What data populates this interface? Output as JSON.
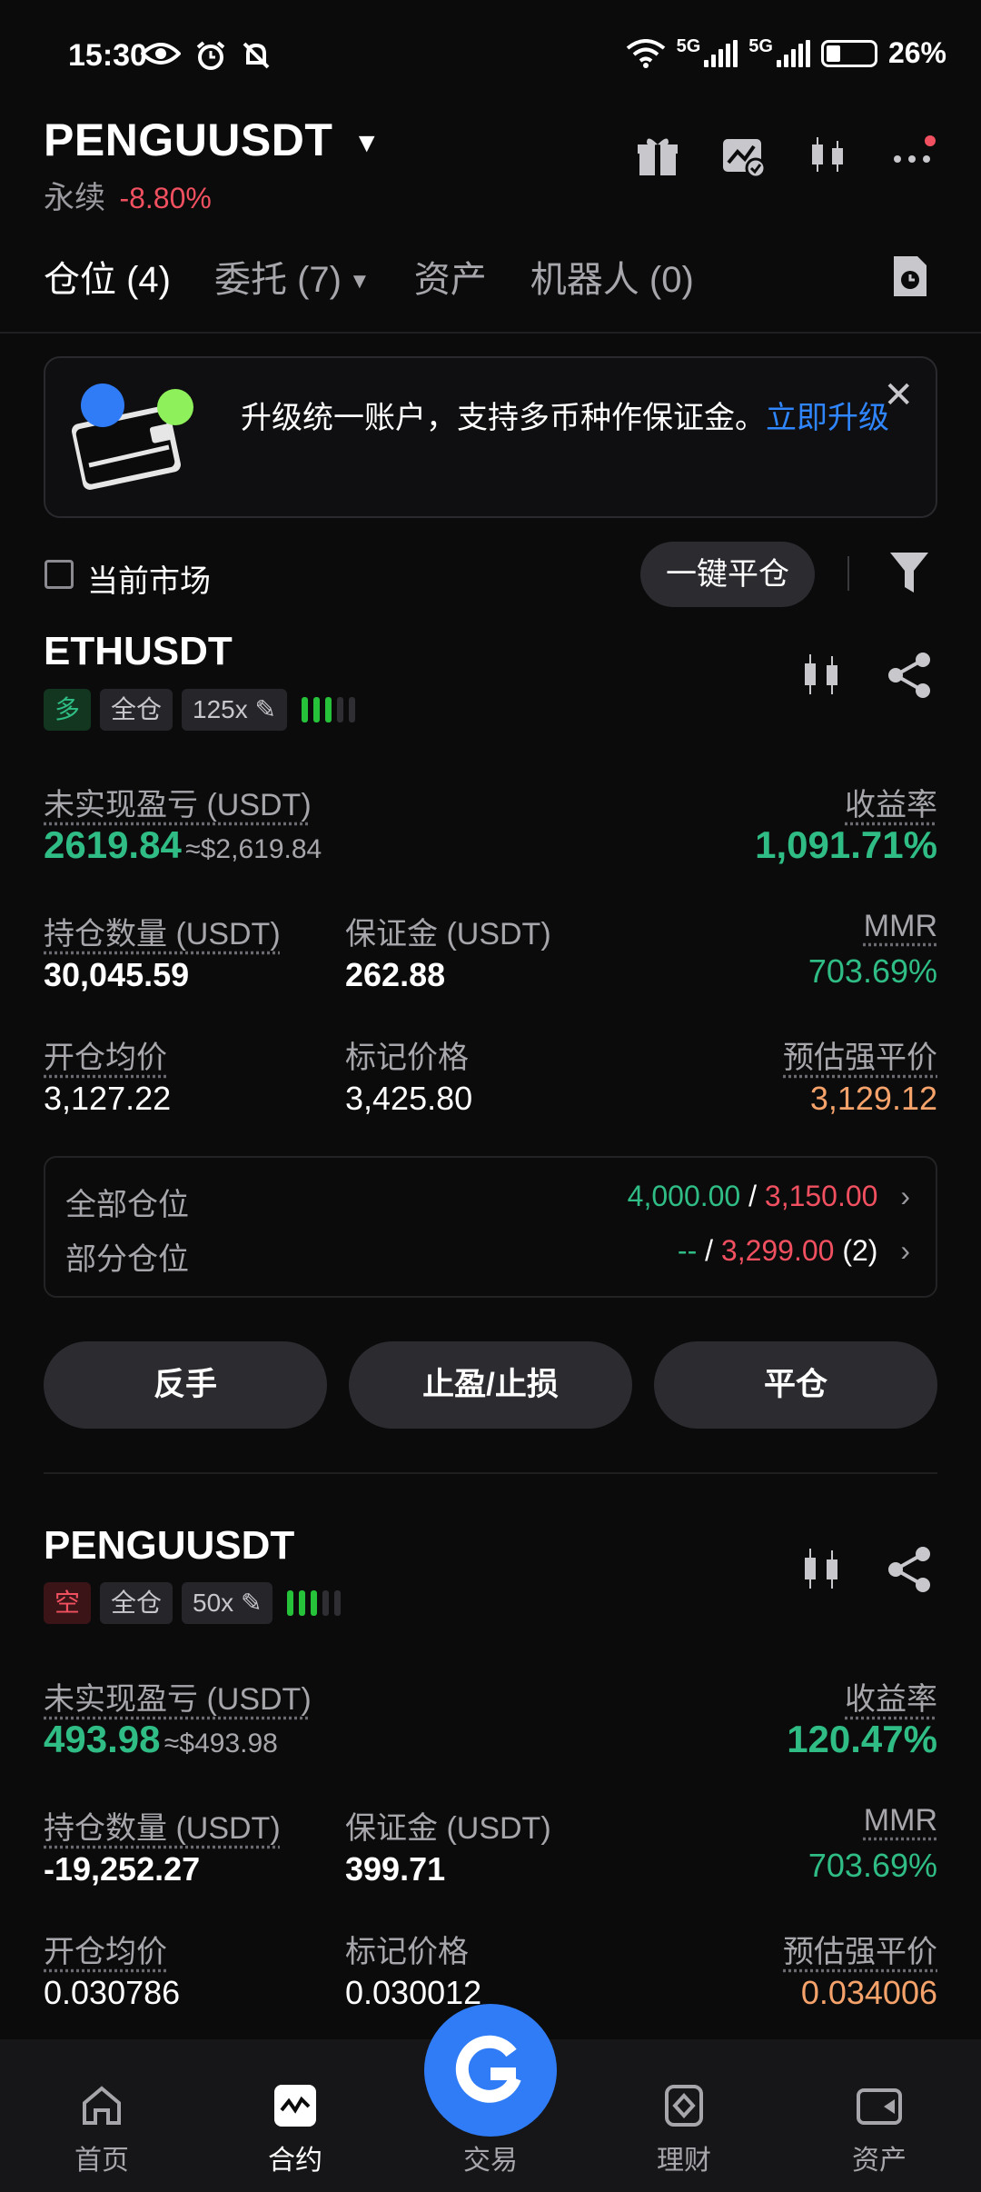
{
  "status_bar": {
    "time": "15:30",
    "battery": "26%",
    "net1": "5G",
    "net2": "5G"
  },
  "header": {
    "symbol": "PENGUUSDT",
    "contract_type": "永续",
    "change": "-8.80%"
  },
  "tabs": [
    {
      "label": "仓位 (4)"
    },
    {
      "label": "委托 (7)"
    },
    {
      "label": "资产"
    },
    {
      "label": "机器人 (0)"
    }
  ],
  "banner": {
    "text": "升级统一账户，支持多币种作保证金。",
    "link": "立即升级"
  },
  "filter_row": {
    "current_market": "当前市场",
    "close_all": "一键平仓"
  },
  "positions": [
    {
      "symbol": "ETHUSDT",
      "side": "多",
      "margin_mode": "全仓",
      "leverage": "125x",
      "risk_level": 3,
      "pnl_label": "未实现盈亏 (USDT)",
      "pnl": "2619.84",
      "pnl_usd": "≈$2,619.84",
      "roe_label": "收益率",
      "roe": "1,091.71%",
      "size_label": "持仓数量 (USDT)",
      "size": "30,045.59",
      "margin_label": "保证金 (USDT)",
      "margin": "262.88",
      "mmr_label": "MMR",
      "mmr": "703.69%",
      "entry_label": "开仓均价",
      "entry": "3,127.22",
      "mark_label": "标记价格",
      "mark": "3,425.80",
      "liq_label": "预估强平价",
      "liq": "3,129.12",
      "tpsl_all_label": "全部仓位",
      "tpsl_all_tp": "4,000.00",
      "tpsl_all_sl": "3,150.00",
      "tpsl_part_label": "部分仓位",
      "tpsl_part_tp": "--",
      "tpsl_part_sl": "3,299.00",
      "tpsl_part_count": "(2)",
      "btn_reverse": "反手",
      "btn_tpsl": "止盈/止损",
      "btn_close": "平仓"
    },
    {
      "symbol": "PENGUUSDT",
      "side": "空",
      "margin_mode": "全仓",
      "leverage": "50x",
      "risk_level": 3,
      "pnl_label": "未实现盈亏 (USDT)",
      "pnl": "493.98",
      "pnl_usd": "≈$493.98",
      "roe_label": "收益率",
      "roe": "120.47%",
      "size_label": "持仓数量 (USDT)",
      "size": "-19,252.27",
      "margin_label": "保证金 (USDT)",
      "margin": "399.71",
      "mmr_label": "MMR",
      "mmr": "703.69%",
      "entry_label": "开仓均价",
      "entry": "0.030786",
      "mark_label": "标记价格",
      "mark": "0.030012",
      "liq_label": "预估强平价",
      "liq": "0.034006"
    }
  ],
  "bottom_nav": [
    {
      "label": "首页",
      "icon": "home-icon"
    },
    {
      "label": "合约",
      "icon": "futures-icon"
    },
    {
      "label": "交易",
      "icon": "trade-icon"
    },
    {
      "label": "理财",
      "icon": "earn-icon"
    },
    {
      "label": "资产",
      "icon": "wallet-icon"
    }
  ],
  "colors": {
    "green": "#2fbd85",
    "red": "#f0505f",
    "orange": "#f5a36b",
    "blue": "#2f86ff"
  }
}
